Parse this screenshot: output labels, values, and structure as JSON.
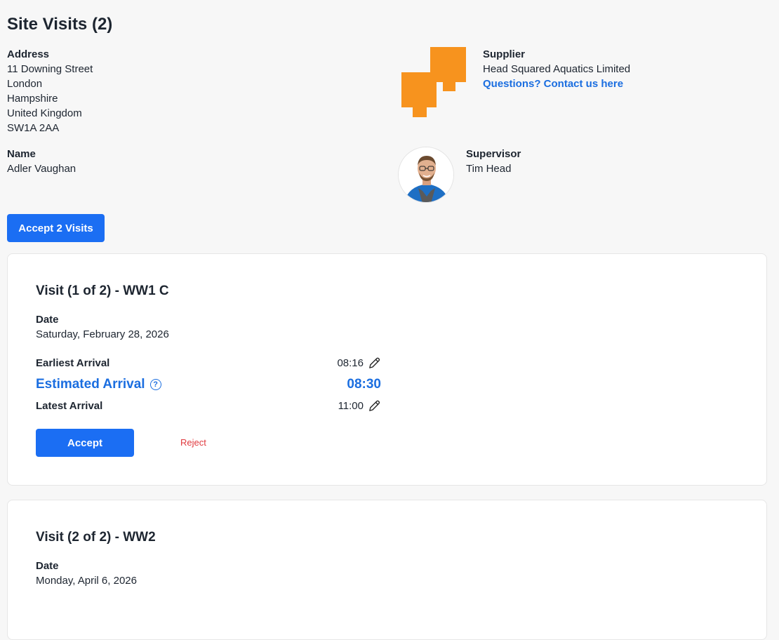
{
  "page": {
    "title": "Site Visits (2)"
  },
  "address": {
    "label": "Address",
    "lines": [
      "11 Downing Street",
      "London",
      "Hampshire",
      "United Kingdom",
      "SW1A 2AA"
    ]
  },
  "customer": {
    "label": "Name",
    "value": "Adler Vaughan"
  },
  "supplier": {
    "label": "Supplier",
    "name": "Head Squared Aquatics Limited",
    "contact_link": "Questions? Contact us here",
    "logo_color": "#f7931e"
  },
  "supervisor": {
    "label": "Supervisor",
    "name": "Tim Head"
  },
  "accept_all_label": "Accept 2 Visits",
  "colors": {
    "primary": "#1b6ef3",
    "link": "#1b6ee0",
    "reject": "#e0393e"
  },
  "visits": [
    {
      "title": "Visit (1 of 2) - WW1 C",
      "date_label": "Date",
      "date": "Saturday, February 28, 2026",
      "earliest_label": "Earliest Arrival",
      "earliest": "08:16",
      "estimated_label": "Estimated Arrival",
      "estimated": "08:30",
      "latest_label": "Latest Arrival",
      "latest": "11:00",
      "accept_label": "Accept",
      "reject_label": "Reject"
    },
    {
      "title": "Visit (2 of 2) - WW2",
      "date_label": "Date",
      "date": "Monday, April 6, 2026"
    }
  ]
}
